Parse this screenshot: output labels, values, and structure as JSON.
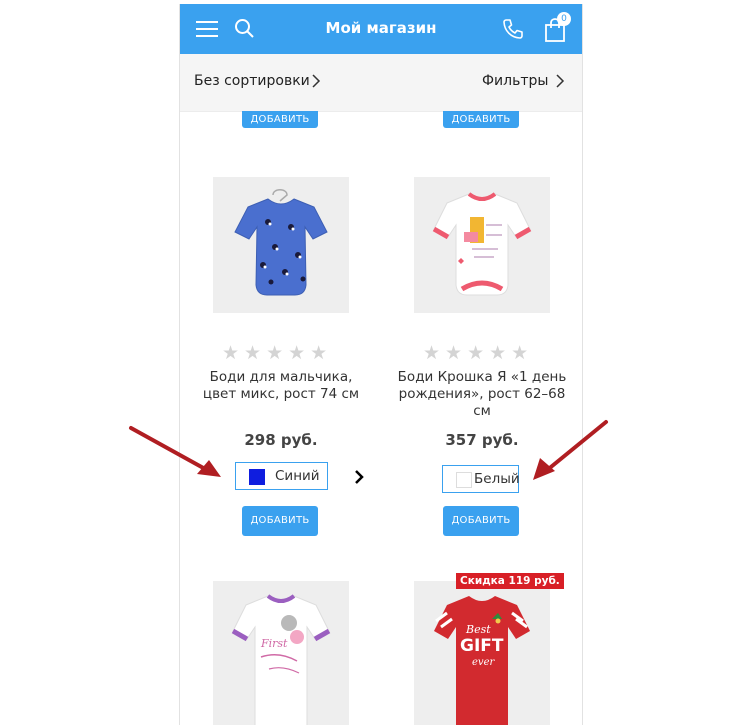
{
  "header": {
    "title": "Мой магазин",
    "cart_count": "0",
    "accent_color": "#3aa1ef",
    "icons": [
      "menu-icon",
      "search-icon",
      "phone-icon",
      "cart-icon"
    ]
  },
  "toolbar": {
    "sort_label": "Без сортировки",
    "filter_label": "Фильтры"
  },
  "add_button_label": "ДОБАВИТЬ",
  "products": [
    {
      "name": "Боди для мальчика, цвет микс, рост 74 см",
      "price": "298 руб.",
      "color_option": "Синий",
      "color_hex": "#0f1ddf",
      "rating": 0
    },
    {
      "name": "Боди Крошка Я «1 день рождения», рост 62–68 см",
      "price": "357 руб.",
      "color_option": "Белый",
      "color_hex": "#ffffff",
      "rating": 0
    },
    {
      "name": "",
      "price": "",
      "color_option": ""
    },
    {
      "name": "",
      "price": "",
      "color_option": "",
      "discount_badge": "Скидка 119 руб."
    }
  ],
  "annotation_color": "#b01e22"
}
